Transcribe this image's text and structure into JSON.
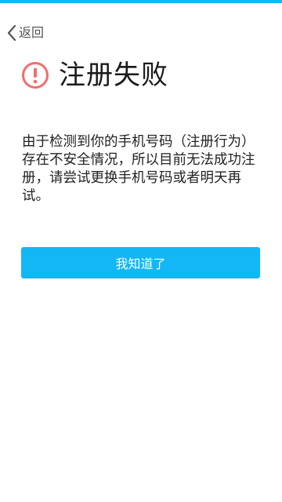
{
  "theme": {
    "accent_color": "#12b7f5",
    "alert_color": "#f26d6d"
  },
  "nav": {
    "back_label": "返回",
    "back_icon": "chevron-left-icon"
  },
  "header": {
    "title": "注册失败",
    "icon": "alert-circle-icon"
  },
  "body": {
    "message": "由于检测到你的手机号码（注册行为）存在不安全情况，所以目前无法成功注册，请尝试更换手机号码或者明天再试。"
  },
  "actions": {
    "confirm_label": "我知道了"
  }
}
